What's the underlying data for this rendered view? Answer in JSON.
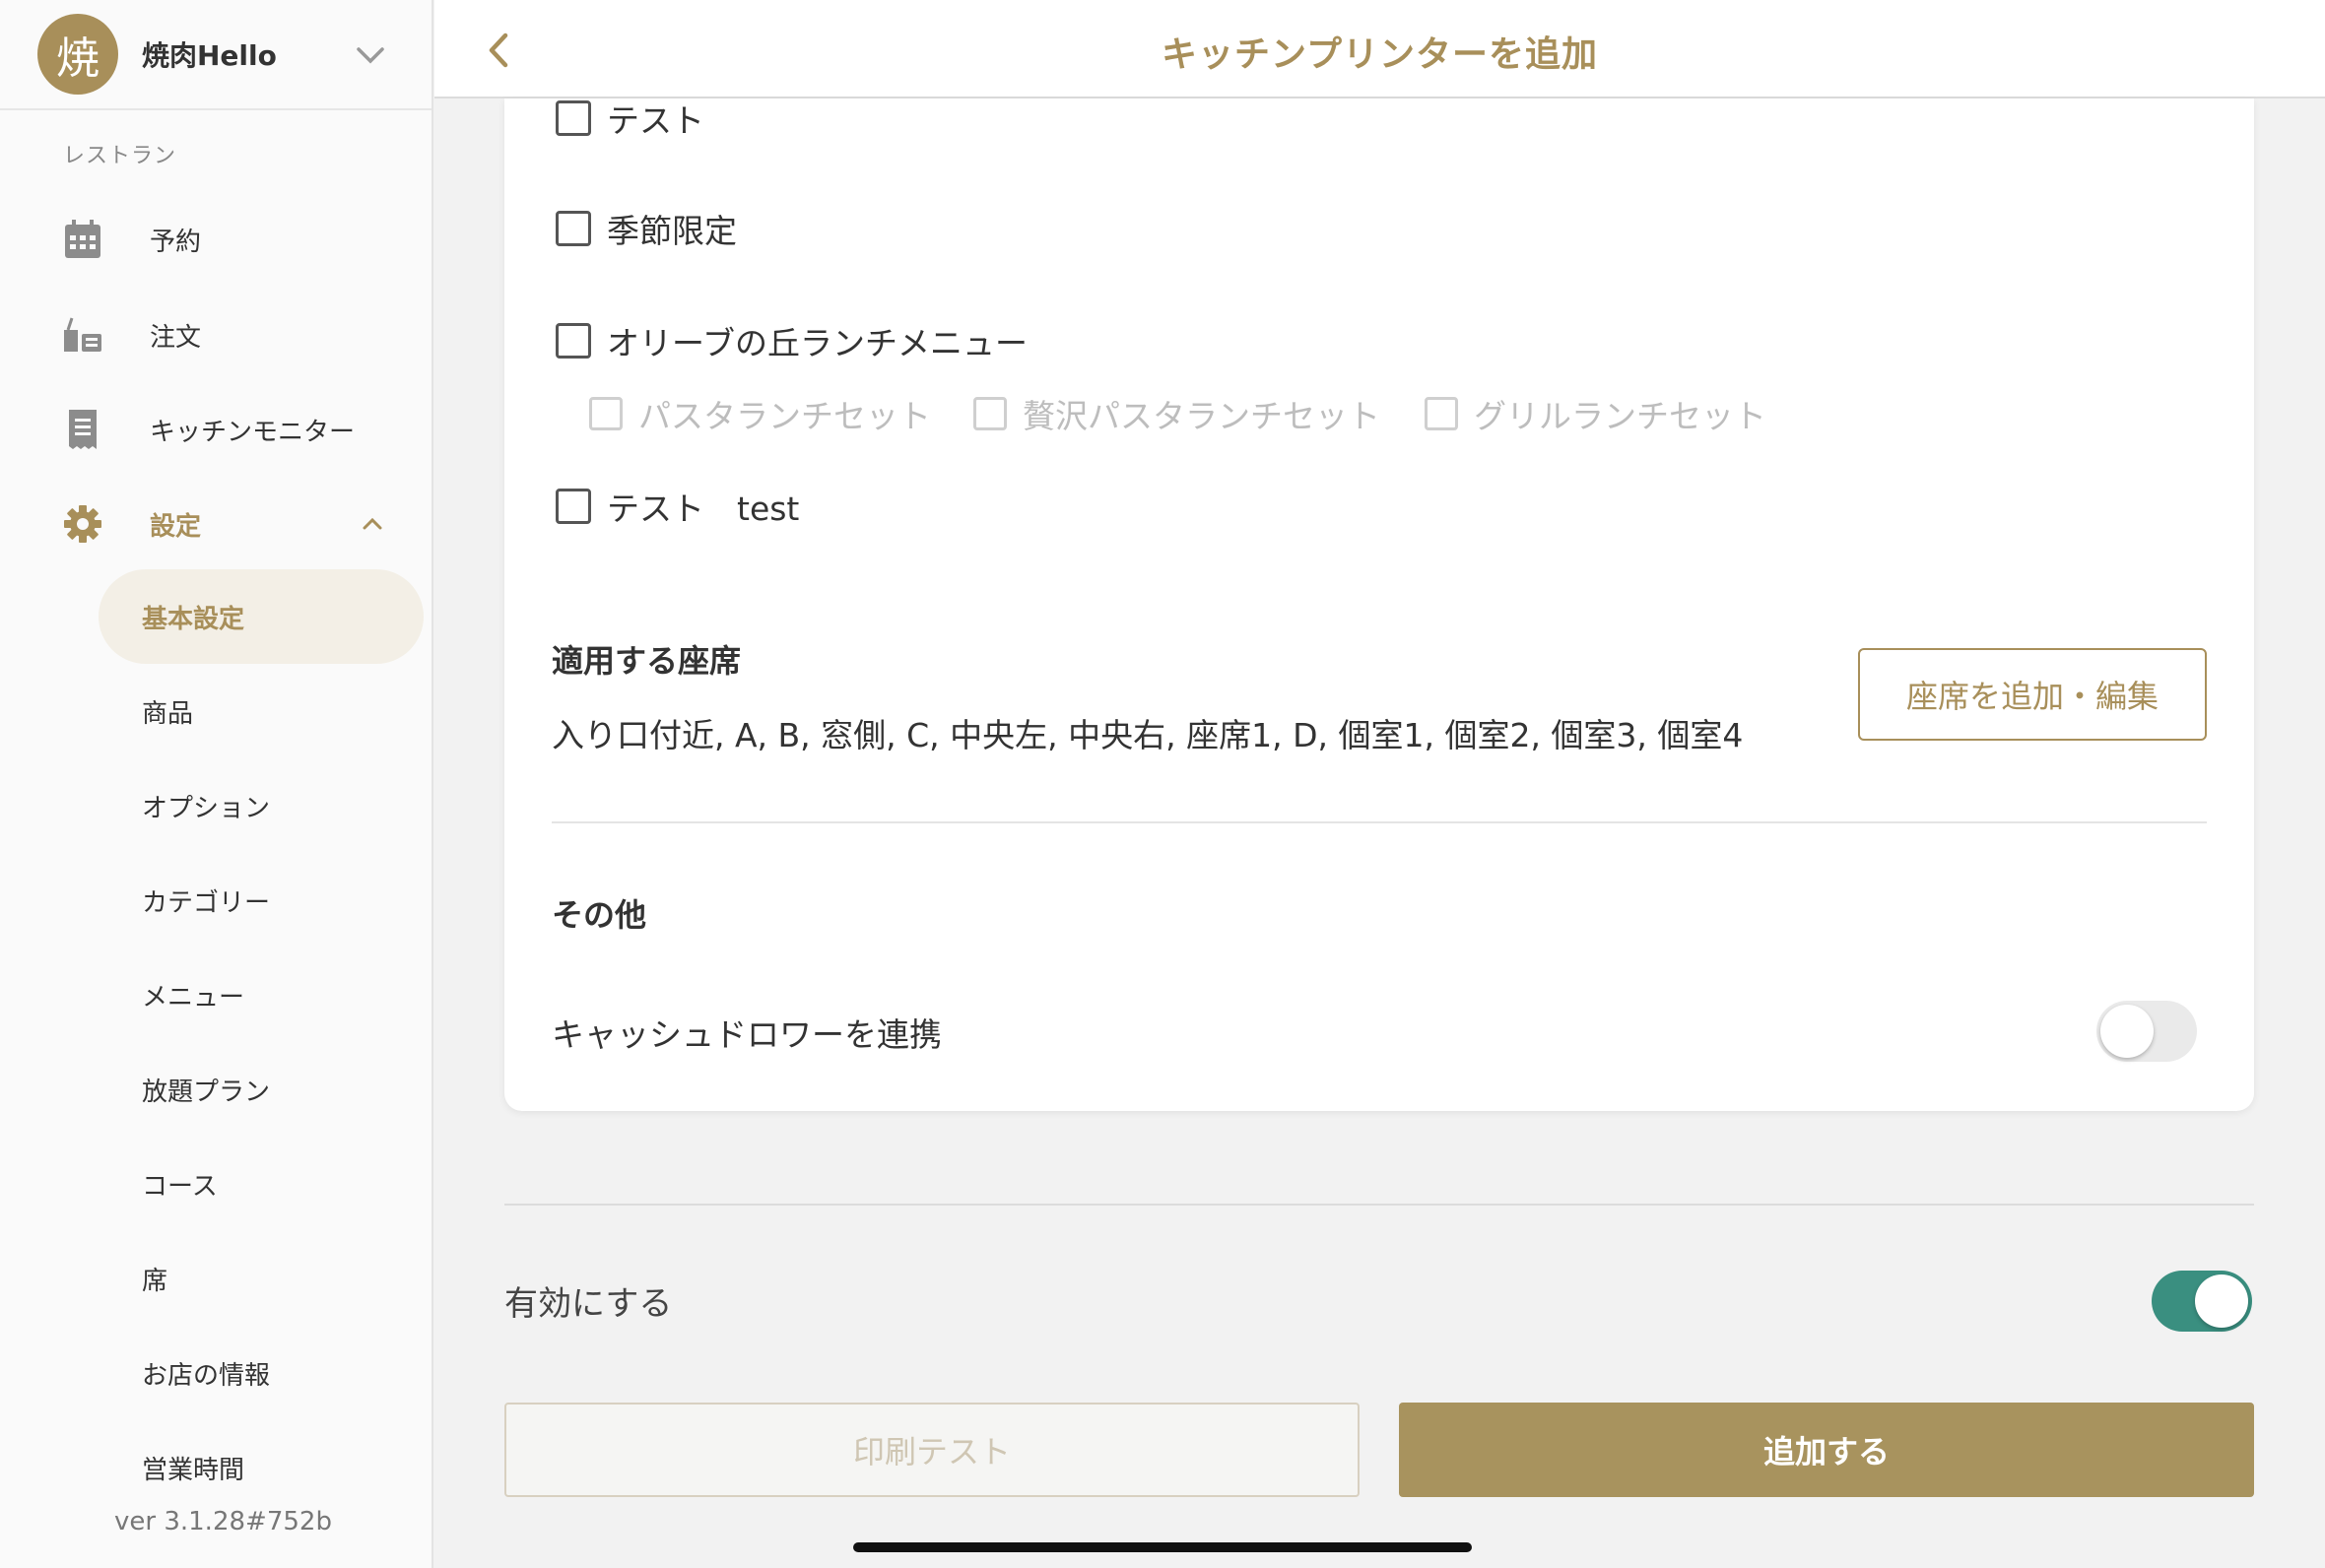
{
  "sidebar": {
    "store": {
      "avatar_char": "焼",
      "name": "焼肉Hello"
    },
    "section_label": "レストラン",
    "nav": [
      {
        "label": "予約",
        "icon": "calendar-icon"
      },
      {
        "label": "注文",
        "icon": "order-icon"
      },
      {
        "label": "キッチンモニター",
        "icon": "receipt-icon"
      },
      {
        "label": "設定",
        "icon": "gear-icon"
      }
    ],
    "settings_sub": [
      "基本設定",
      "商品",
      "オプション",
      "カテゴリー",
      "メニュー",
      "放題プラン",
      "コース",
      "席",
      "お店の情報",
      "営業時間"
    ],
    "version": "ver 3.1.28#752b"
  },
  "topbar": {
    "title": "キッチンプリンターを追加"
  },
  "menus": {
    "items": [
      {
        "label": "テスト"
      },
      {
        "label": "季節限定"
      },
      {
        "label": "オリーブの丘ランチメニュー"
      },
      {
        "label": "テスト　test"
      }
    ],
    "sub_items": [
      "パスタランチセット",
      "贅沢パスタランチセット",
      "グリルランチセット"
    ]
  },
  "seats": {
    "title": "適用する座席",
    "list": "入り口付近, A, B, 窓側, C, 中央左, 中央右, 座席1, D, 個室1, 個室2, 個室3, 個室4",
    "edit_button": "座席を追加・編集"
  },
  "other": {
    "title": "その他",
    "cash_drawer_label": "キャッシュドロワーを連携",
    "cash_drawer_on": false
  },
  "bottom": {
    "enable_label": "有効にする",
    "enable_on": true,
    "test_print_button": "印刷テスト",
    "add_button": "追加する"
  },
  "colors": {
    "accent": "#a88f5a",
    "toggle_on": "#3a8f80"
  }
}
